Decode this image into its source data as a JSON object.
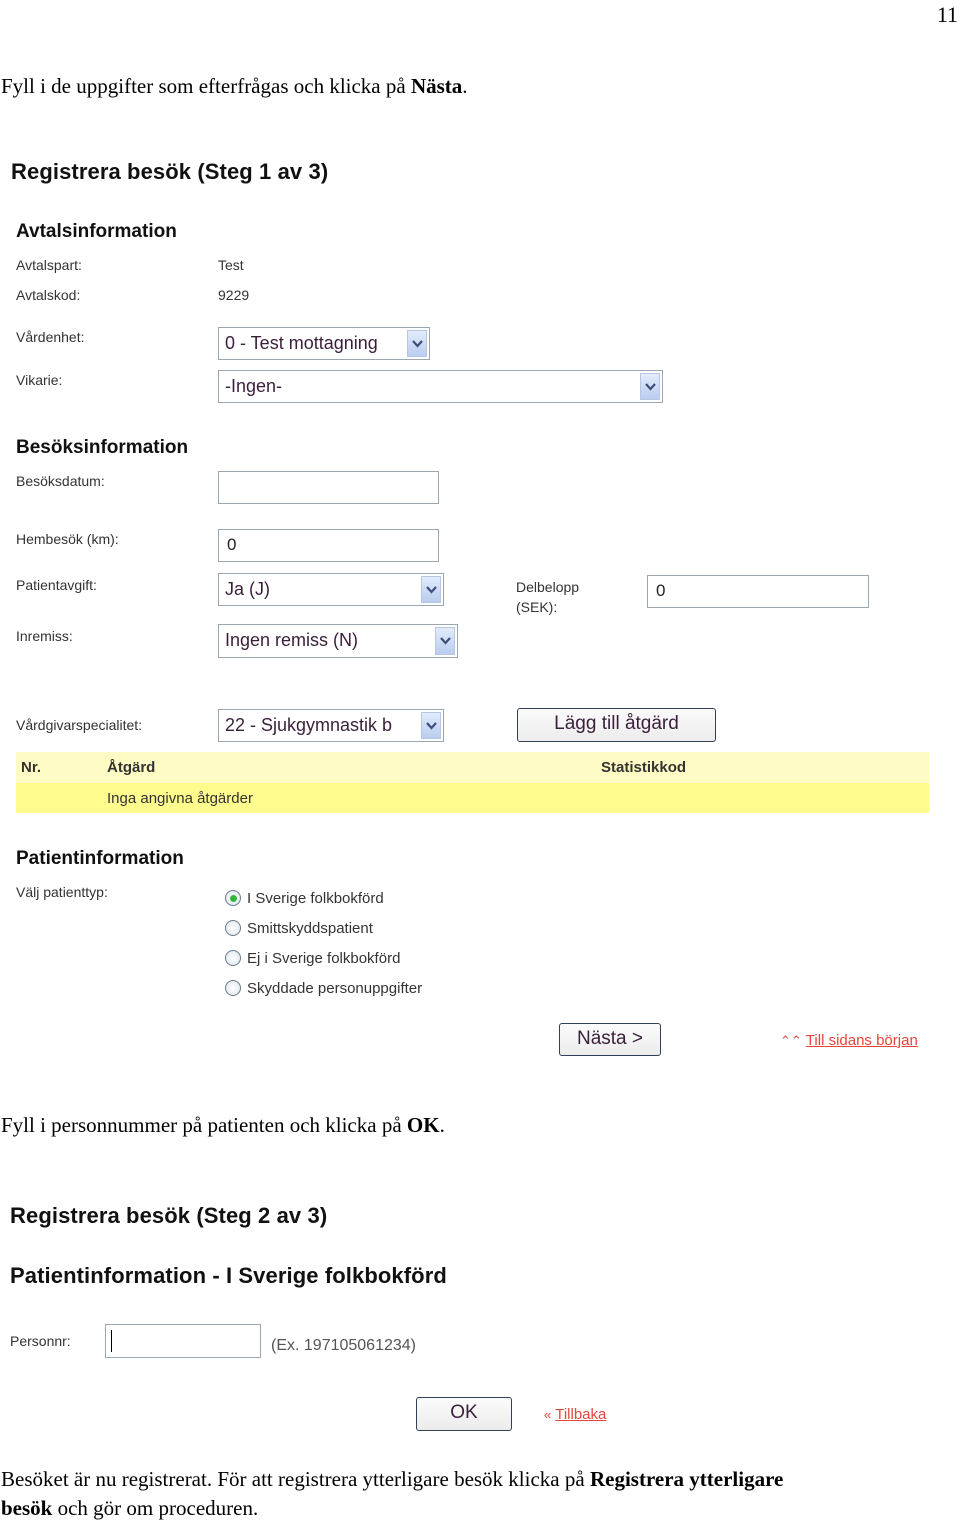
{
  "page_number": "11",
  "instructions": {
    "step1": {
      "text": "Fyll i de uppgifter som efterfrågas och klicka på ",
      "bold": "Nästa",
      "suffix": "."
    },
    "step2": {
      "text": "Fyll i personnummer på patienten och klicka på ",
      "bold": "OK",
      "suffix": "."
    },
    "step3": {
      "text": "Besöket är nu registrerat. För att registrera ytterligare besök klicka på ",
      "bold1": "Registrera ytterligare",
      "bold2": "besök",
      "suffix": " och gör om proceduren."
    }
  },
  "step1_form": {
    "title": "Registrera besök (Steg 1 av 3)",
    "avtal": {
      "heading": "Avtalsinformation",
      "avtalspart_label": "Avtalspart:",
      "avtalspart_value": "Test",
      "avtalskod_label": "Avtalskod:",
      "avtalskod_value": "9229",
      "vardenhet_label": "Vårdenhet:",
      "vardenhet_value": "0 - Test mottagning",
      "vikarie_label": "Vikarie:",
      "vikarie_value": "-Ingen-"
    },
    "besok": {
      "heading": "Besöksinformation",
      "besoksdatum_label": "Besöksdatum:",
      "besoksdatum_value": "",
      "hembesok_label": "Hembesök (km):",
      "hembesok_value": "0",
      "patientavgift_label": "Patientavgift:",
      "patientavgift_value": "Ja (J)",
      "delbelopp_label_1": "Delbelopp",
      "delbelopp_label_2": "(SEK):",
      "delbelopp_value": "0",
      "inremiss_label": "Inremiss:",
      "inremiss_value": "Ingen remiss (N)",
      "specialitet_label": "Vårdgivarspecialitet:",
      "specialitet_value": "22 - Sjukgymnastik b",
      "add_button": "Lägg till åtgärd"
    },
    "atgard_table": {
      "columns": [
        "Nr.",
        "Åtgärd",
        "Statistikkod"
      ],
      "empty_text": "Inga angivna åtgärder"
    },
    "patient": {
      "heading": "Patientinformation",
      "type_label": "Välj patienttyp:",
      "options": [
        {
          "label": "I Sverige folkbokförd",
          "selected": true
        },
        {
          "label": "Smittskyddspatient",
          "selected": false
        },
        {
          "label": "Ej i Sverige folkbokförd",
          "selected": false
        },
        {
          "label": "Skyddade personuppgifter",
          "selected": false
        }
      ]
    },
    "next_button": "Nästa >",
    "top_link": "Till sidans början",
    "top_link_icon": "double-chevron-up-icon"
  },
  "step2_form": {
    "title": "Registrera besök (Steg 2 av 3)",
    "subtitle": "Patientinformation - I Sverige folkbokförd",
    "personnr_label": "Personnr:",
    "personnr_value": "",
    "personnr_hint": "(Ex. 197105061234)",
    "ok_button": "OK",
    "back_link": "Tillbaka",
    "back_link_icon": "double-chevron-left-icon"
  },
  "colors": {
    "table_header_bg": "#fffbc4",
    "table_row_bg": "#fffb8c",
    "link": "#e5463a",
    "radio_selected": "#2fb83a"
  }
}
